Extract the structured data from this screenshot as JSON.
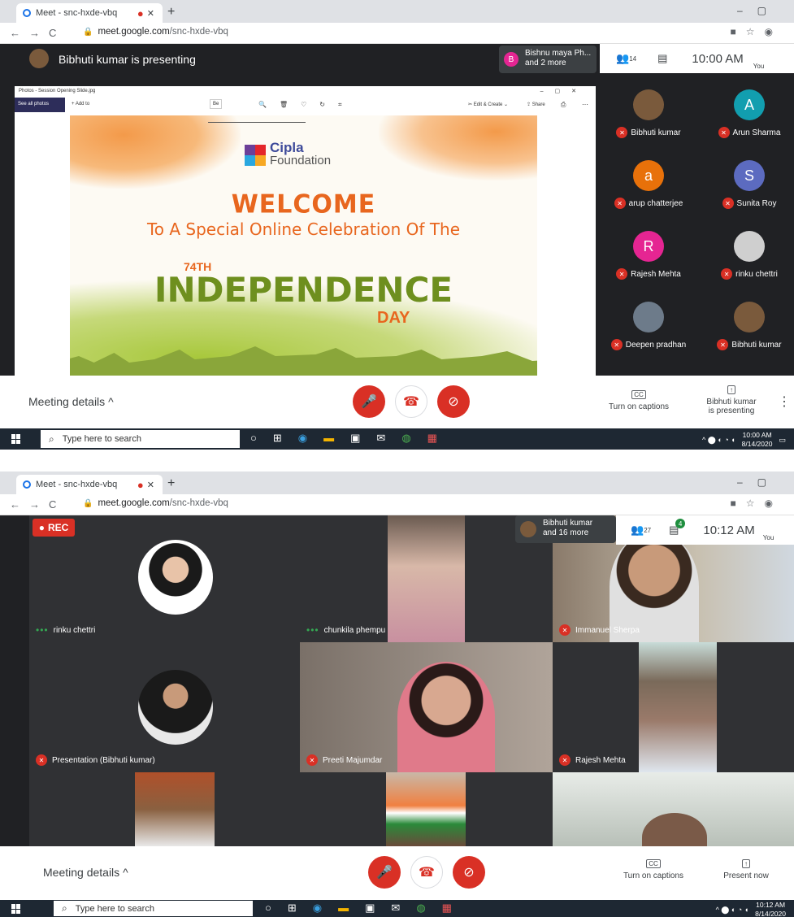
{
  "shot1": {
    "tab_title": "Meet - snc-hxde-vbq",
    "url_host": "meet.google.com",
    "url_path": "/snc-hxde-vbq",
    "presenter_banner": "Bibhuti kumar is presenting",
    "joined_name": "Bishnu maya Ph...",
    "joined_more": "and 2 more",
    "joined_initial": "B",
    "people_count": "14",
    "time": "10:00 AM",
    "you_label": "You",
    "photos_title": "Photos - Session Opening Slide.jpg",
    "see_all_photos": "See all photos",
    "add_to": "Add to",
    "edit_create": "Edit & Create",
    "share": "Share",
    "tooltip_fragment": "Be",
    "slide": {
      "brand_line1": "Cipla",
      "brand_line2": "Foundation",
      "welcome": "WELCOME",
      "subtitle": "To A Special Online Celebration Of The",
      "ordinal": "74TH",
      "independence": "INDEPENDENCE",
      "day": "DAY"
    },
    "participants": [
      {
        "name": "Bibhuti kumar",
        "initial": "",
        "color": "#7a5a3c"
      },
      {
        "name": "Arun Sharma",
        "initial": "A",
        "color": "#129eaf"
      },
      {
        "name": "arup chatterjee",
        "initial": "a",
        "color": "#e8710a"
      },
      {
        "name": "Sunita Roy",
        "initial": "S",
        "color": "#5c6bc0"
      },
      {
        "name": "Rajesh Mehta",
        "initial": "R",
        "color": "#e52592"
      },
      {
        "name": "rinku chettri",
        "initial": "",
        "color": "#cfcfcf"
      },
      {
        "name": "Deepen pradhan",
        "initial": "",
        "color": "#6d7b8a"
      },
      {
        "name": "Bibhuti kumar",
        "initial": "",
        "color": "#7a5a3c"
      }
    ],
    "meeting_details": "Meeting details",
    "captions_label": "Turn on captions",
    "present_line1": "Bibhuti kumar",
    "present_line2": "is presenting",
    "search_placeholder": "Type here to search",
    "clock_time": "10:00 AM",
    "clock_date": "8/14/2020"
  },
  "shot2": {
    "tab_title": "Meet - snc-hxde-vbq",
    "url_host": "meet.google.com",
    "url_path": "/snc-hxde-vbq",
    "rec_label": "REC",
    "joined_name": "Bibhuti kumar",
    "joined_more": "and 16 more",
    "people_count": "27",
    "chat_badge": "4",
    "time": "10:12 AM",
    "you_label": "You",
    "tiles": [
      {
        "name": "rinku chettri"
      },
      {
        "name": "chunkila phempu"
      },
      {
        "name": "Immanuel Sherpa"
      },
      {
        "name": "Presentation (Bibhuti kumar)"
      },
      {
        "name": "Preeti Majumdar"
      },
      {
        "name": "Rajesh Mehta"
      }
    ],
    "meeting_details": "Meeting details",
    "captions_label": "Turn on captions",
    "present_now": "Present now",
    "search_placeholder": "Type here to search",
    "clock_time": "10:12 AM",
    "clock_date": "8/14/2020"
  }
}
